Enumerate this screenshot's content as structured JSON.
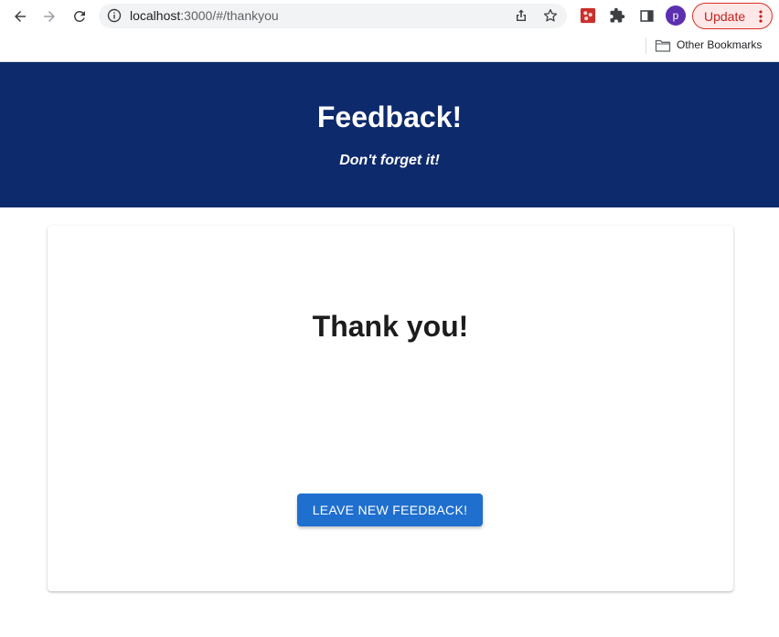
{
  "browser": {
    "url_host": "localhost",
    "url_path": ":3000/#/thankyou",
    "profile_initial": "p",
    "update_label": "Update",
    "bookmarks": {
      "folder_label": "Other Bookmarks"
    },
    "icons": {
      "back": "arrow-left-icon",
      "forward": "arrow-right-icon",
      "reload": "reload-icon",
      "site_info": "info-icon",
      "share": "share-icon",
      "bookmark": "star-icon",
      "extension": "extension-app-icon",
      "extensions_menu": "puzzle-icon",
      "side_panel": "side-panel-icon",
      "menu": "kebab-menu-icon",
      "folder": "folder-icon"
    },
    "colors": {
      "update_accent": "#d93025",
      "avatar": "#5b2fb0"
    }
  },
  "header": {
    "title": "Feedback!",
    "subtitle": "Don't forget it!",
    "background": "#0d2a6c"
  },
  "card": {
    "heading": "Thank you!",
    "button_label": "LEAVE NEW FEEDBACK!",
    "button_color": "#1f6fcf"
  }
}
